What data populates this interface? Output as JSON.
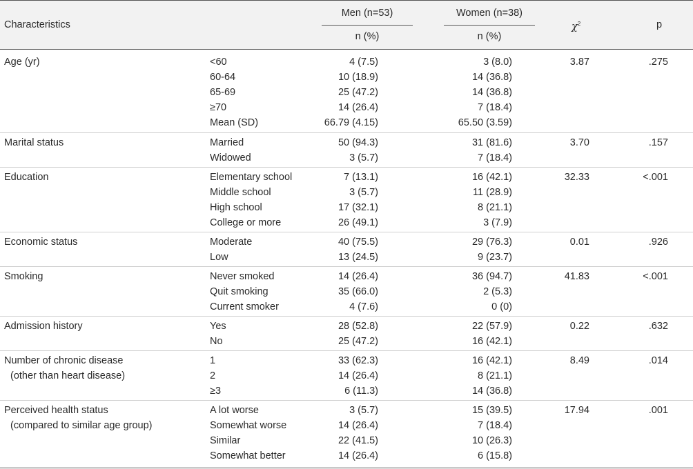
{
  "header": {
    "characteristics": "Characteristics",
    "men": "Men (n=53)",
    "women": "Women (n=38)",
    "men_sub": "n (%)",
    "women_sub": "n (%)",
    "chi": "χ",
    "chi_sup": "2",
    "p": "p"
  },
  "groups": [
    {
      "label": [
        "Age (yr)"
      ],
      "rows": [
        {
          "cat": "<60",
          "men": "4 (7.5)",
          "women": "3 (8.0)"
        },
        {
          "cat": "60-64",
          "men": "10 (18.9)",
          "women": "14 (36.8)"
        },
        {
          "cat": "65-69",
          "men": "25 (47.2)",
          "women": "14 (36.8)"
        },
        {
          "cat": "≥70",
          "men": "14 (26.4)",
          "women": "7 (18.4)"
        },
        {
          "cat": "Mean (SD)",
          "men": "66.79 (4.15)",
          "women": "65.50 (3.59)"
        }
      ],
      "chi": "3.87",
      "p": ".275"
    },
    {
      "label": [
        "Marital status"
      ],
      "rows": [
        {
          "cat": "Married",
          "men": "50 (94.3)",
          "women": "31 (81.6)"
        },
        {
          "cat": "Widowed",
          "men": "3 (5.7)",
          "women": "7 (18.4)"
        }
      ],
      "chi": "3.70",
      "p": ".157"
    },
    {
      "label": [
        "Education"
      ],
      "rows": [
        {
          "cat": "Elementary school",
          "men": "7 (13.1)",
          "women": "16 (42.1)"
        },
        {
          "cat": "Middle school",
          "men": "3 (5.7)",
          "women": "11 (28.9)"
        },
        {
          "cat": "High school",
          "men": "17 (32.1)",
          "women": "8 (21.1)"
        },
        {
          "cat": "College or more",
          "men": "26 (49.1)",
          "women": "3 (7.9)"
        }
      ],
      "chi": "32.33",
      "p": "<.001"
    },
    {
      "label": [
        "Economic status"
      ],
      "rows": [
        {
          "cat": "Moderate",
          "men": "40 (75.5)",
          "women": "29 (76.3)"
        },
        {
          "cat": "Low",
          "men": "13 (24.5)",
          "women": "9 (23.7)"
        }
      ],
      "chi": "0.01",
      "p": ".926"
    },
    {
      "label": [
        "Smoking"
      ],
      "rows": [
        {
          "cat": "Never smoked",
          "men": "14 (26.4)",
          "women": "36 (94.7)"
        },
        {
          "cat": "Quit smoking",
          "men": "35 (66.0)",
          "women": "2 (5.3)"
        },
        {
          "cat": "Current smoker",
          "men": "4 (7.6)",
          "women": "0 (0)"
        }
      ],
      "chi": "41.83",
      "p": "<.001"
    },
    {
      "label": [
        "Admission history"
      ],
      "rows": [
        {
          "cat": "Yes",
          "men": "28 (52.8)",
          "women": "22 (57.9)"
        },
        {
          "cat": "No",
          "men": "25 (47.2)",
          "women": "16 (42.1)"
        }
      ],
      "chi": "0.22",
      "p": ".632"
    },
    {
      "label": [
        "Number of chronic disease",
        "(other than heart disease)"
      ],
      "rows": [
        {
          "cat": "1",
          "men": "33 (62.3)",
          "women": "16 (42.1)"
        },
        {
          "cat": "2",
          "men": "14 (26.4)",
          "women": "8 (21.1)"
        },
        {
          "cat": "≥3",
          "men": "6 (11.3)",
          "women": "14 (36.8)"
        }
      ],
      "chi": "8.49",
      "p": ".014"
    },
    {
      "label": [
        "Perceived health status",
        "(compared to similar age group)"
      ],
      "rows": [
        {
          "cat": "A lot worse",
          "men": "3 (5.7)",
          "women": "15 (39.5)"
        },
        {
          "cat": "Somewhat worse",
          "men": "14 (26.4)",
          "women": "7 (18.4)"
        },
        {
          "cat": "Similar",
          "men": "22 (41.5)",
          "women": "10 (26.3)"
        },
        {
          "cat": "Somewhat better",
          "men": "14 (26.4)",
          "women": "6 (15.8)"
        }
      ],
      "chi": "17.94",
      "p": ".001"
    }
  ]
}
